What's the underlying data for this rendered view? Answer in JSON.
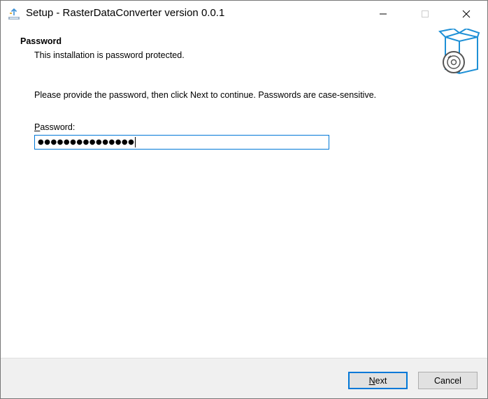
{
  "window": {
    "title": "Setup - RasterDataConverter version 0.0.1",
    "controls": {
      "minimize_icon": "minimize-icon",
      "maximize_icon": "maximize-icon",
      "close_icon": "close-icon"
    }
  },
  "page": {
    "heading": "Password",
    "subheading": "This installation is password protected.",
    "instruction": "Please provide the password, then click Next to continue. Passwords are case-sensitive."
  },
  "password_field": {
    "label_accel": "P",
    "label_rest": "assword:",
    "masked_value": "●●●●●●●●●●●●●●●"
  },
  "buttons": {
    "next_accel": "N",
    "next_rest": "ext",
    "cancel": "Cancel"
  },
  "colors": {
    "focus_blue": "#0078d7",
    "footer_bg": "#f0f0f0",
    "icon_blue": "#1e90d6",
    "icon_gray": "#555555"
  }
}
